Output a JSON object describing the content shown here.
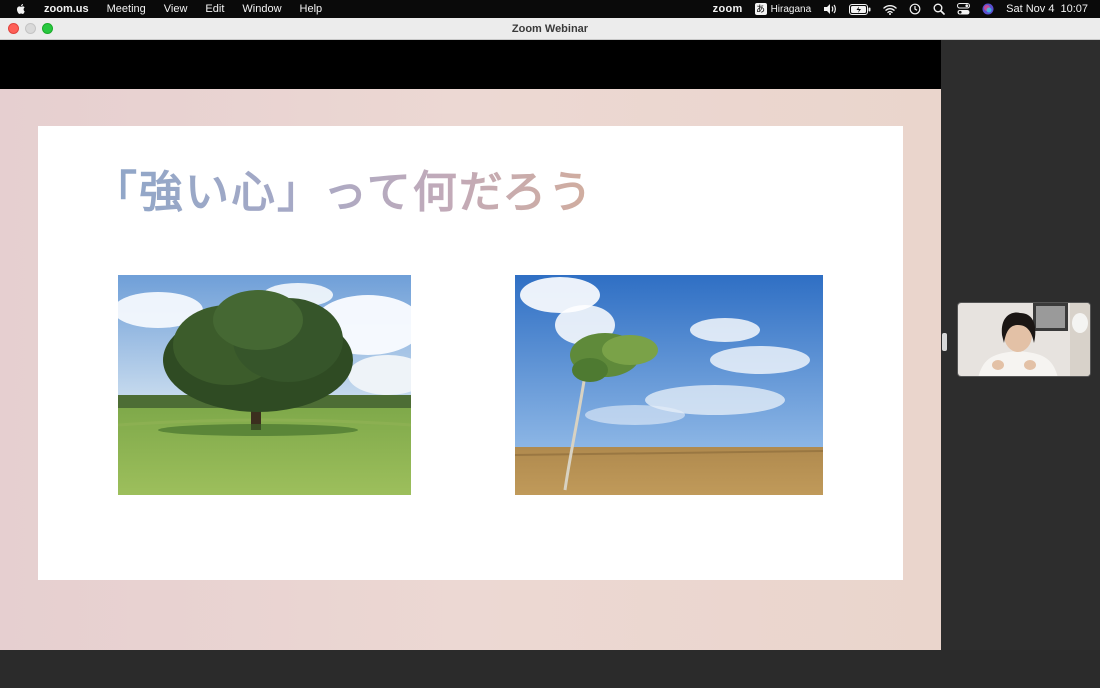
{
  "menubar": {
    "app_name": "zoom.us",
    "menus": [
      "Meeting",
      "View",
      "Edit",
      "Window",
      "Help"
    ],
    "zoom_logo": "zoom",
    "ime_glyph": "あ",
    "ime_label": "Hiragana",
    "date": "Sat Nov 4",
    "time": "10:07",
    "icons": [
      "apple-icon",
      "volume-icon",
      "battery-icon",
      "wifi-icon",
      "time-machine-icon",
      "search-icon",
      "control-center-icon",
      "siri-icon"
    ]
  },
  "window": {
    "title": "Zoom Webinar"
  },
  "slide": {
    "title": "「強い心」って何だろう"
  },
  "colors": {
    "title_gradient_start": "#8da6c8",
    "title_gradient_end": "#d1ad9e",
    "slide_frame": "#e9d4d0",
    "panel_bg": "#2d2d2d"
  }
}
